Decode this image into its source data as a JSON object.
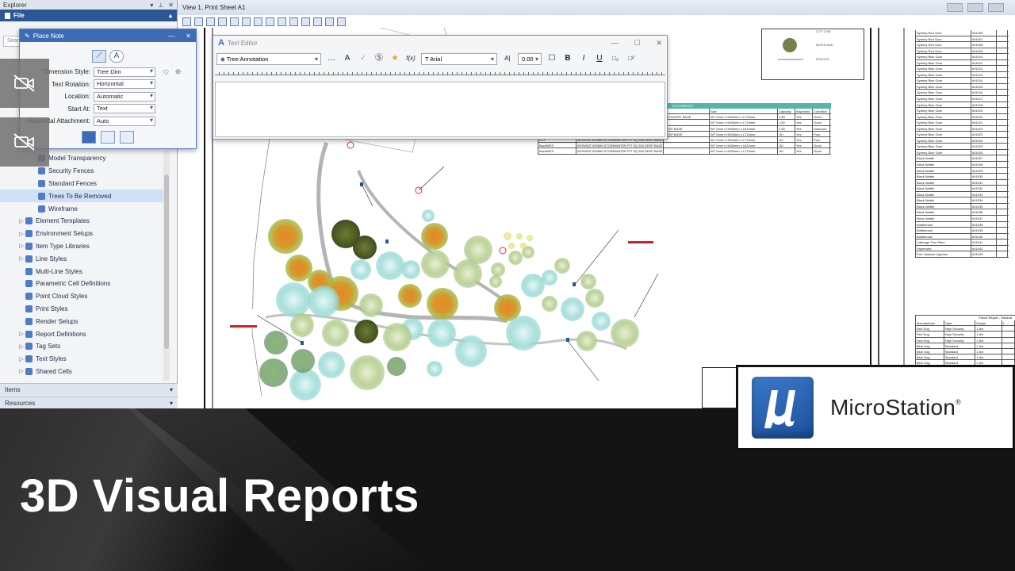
{
  "explorer": {
    "title": "Explorer",
    "file_tab": "File",
    "search_placeholder": "Sear",
    "tree_items": [
      {
        "label": "Model Transparency",
        "level": 2
      },
      {
        "label": "Security Fences",
        "level": 2
      },
      {
        "label": "Standard Fences",
        "level": 2
      },
      {
        "label": "Trees To Be Removed",
        "level": 2,
        "selected": true
      },
      {
        "label": "Wireframe",
        "level": 2
      },
      {
        "label": "Element Templates",
        "level": 1,
        "expandable": true
      },
      {
        "label": "Environment Setups",
        "level": 1,
        "expandable": true
      },
      {
        "label": "Item Type Libraries",
        "level": 1,
        "expandable": true
      },
      {
        "label": "Line Styles",
        "level": 1,
        "expandable": true
      },
      {
        "label": "Multi-Line Styles",
        "level": 1
      },
      {
        "label": "Parametric Cell Definitions",
        "level": 1
      },
      {
        "label": "Point Cloud Styles",
        "level": 1
      },
      {
        "label": "Print Styles",
        "level": 1
      },
      {
        "label": "Render Setups",
        "level": 1
      },
      {
        "label": "Report Definitions",
        "level": 1,
        "expandable": true
      },
      {
        "label": "Tag Sets",
        "level": 1,
        "expandable": true
      },
      {
        "label": "Text Styles",
        "level": 1,
        "expandable": true
      },
      {
        "label": "Shared Cells",
        "level": 1,
        "expandable": true
      }
    ],
    "items_section": "Items",
    "resources_section": "Resources"
  },
  "place_note": {
    "title": "Place Note",
    "fields": [
      {
        "label": "Dimension Style:",
        "value": "Tree Dim"
      },
      {
        "label": "Text Rotation:",
        "value": "Horizontal"
      },
      {
        "label": "Location:",
        "value": "Automatic"
      },
      {
        "label": "Start At:",
        "value": "Text"
      },
      {
        "label": "Horizontal Attachment:",
        "value": "Auto"
      }
    ]
  },
  "view": {
    "title": "View 1, Print Sheet A1"
  },
  "text_editor": {
    "title": "Text Editor",
    "style": "Tree Annotation",
    "font": "Arial",
    "size": "0.00",
    "bold": "B",
    "italic": "I",
    "underline": "U"
  },
  "pits_report": {
    "title": "PITS REPORT",
    "headers": [
      "",
      "Type",
      "Size",
      "Capacity",
      "Inspected",
      "Condition"
    ],
    "rows": [
      [
        "",
        "",
        "300 SHORT BASE",
        "WT 0mm x H450mm x L710mm",
        "1.80",
        "Yes",
        "Good"
      ],
      [
        "",
        "",
        "",
        "WT 0mm x H450mm x L710mm",
        "1.50",
        "Yes",
        "Good"
      ],
      [
        "",
        "",
        "DEEP BASE",
        "WT 0mm x H450mm x L810mm",
        "1.50",
        "Yes",
        "Unknown"
      ],
      [
        "",
        "",
        "DEEP BASE",
        "WT 0mm x H500mm x L710mm",
        ".50",
        "Yes",
        "Poor"
      ],
      [
        "ECP",
        "WOWSAT 600MM STORMWATER PIT SQ 300 DEEP BASE",
        "",
        "WT 0mm x H500mm x L710mm",
        ".50",
        "Yes",
        "Poor"
      ],
      [
        "BackWKS",
        "WOWSAT 600MM STORMWATER PIT SQ 300 DEEP BASE",
        "",
        "WT 0mm x H450mm x L810mm",
        ".50",
        "Yes",
        "Good"
      ],
      [
        "BackWKS",
        "WOWSAT 600MM STORMWATER PIT SQ 300 DEEP BASE",
        "",
        "WT 0mm x H450mm x L710mm",
        ".50",
        "Yes",
        "Good"
      ]
    ]
  },
  "tree_list": {
    "rows": [
      [
        "Sydney Red Gum",
        "#01006"
      ],
      [
        "Sydney Red Gum",
        "#01007"
      ],
      [
        "Sydney Red Gum",
        "#01008"
      ],
      [
        "Sydney Red Gum",
        "#01009"
      ],
      [
        "Sydney Blue Gum",
        "#01010"
      ],
      [
        "Sydney Blue Gum",
        "#01011"
      ],
      [
        "Sydney Blue Gum",
        "#01012"
      ],
      [
        "Sydney Blue Gum",
        "#01013"
      ],
      [
        "Sydney Blue Gum",
        "#01014"
      ],
      [
        "Sydney Blue Gum",
        "#01015"
      ],
      [
        "Sydney Blue Gum",
        "#01016"
      ],
      [
        "Sydney Blue Gum",
        "#01017"
      ],
      [
        "Sydney Blue Gum",
        "#01018"
      ],
      [
        "Sydney Blue Gum",
        "#01019"
      ],
      [
        "Sydney Blue Gum",
        "#01020"
      ],
      [
        "Sydney Blue Gum",
        "#01021"
      ],
      [
        "Sydney Blue Gum",
        "#01022"
      ],
      [
        "Sydney Blue Gum",
        "#01023"
      ],
      [
        "Sydney Blue Gum",
        "#01024"
      ],
      [
        "Sydney Blue Gum",
        "#01025"
      ],
      [
        "Sydney Blue Gum",
        "#01026"
      ],
      [
        "Black Wattle",
        "#01027"
      ],
      [
        "Black Wattle",
        "#01028"
      ],
      [
        "Black Wattle",
        "#01029"
      ],
      [
        "Black Wattle",
        "#01030"
      ],
      [
        "Black Wattle",
        "#01031"
      ],
      [
        "Black Wattle",
        "#01032"
      ],
      [
        "Black Wattle",
        "#01033"
      ],
      [
        "Black Wattle",
        "#01034"
      ],
      [
        "Black Wattle",
        "#01035"
      ],
      [
        "Black Wattle",
        "#01036"
      ],
      [
        "Black Wattle",
        "#01037"
      ],
      [
        "Bottlebrush",
        "#01038"
      ],
      [
        "Bottlebrush",
        "#01039"
      ],
      [
        "Bottlebrush",
        "#01040"
      ],
      [
        "Cabbage Tree Palm",
        "#01041"
      ],
      [
        "Paperbark",
        "#01042"
      ],
      [
        "Port Jackson Cypress",
        "#01043"
      ]
    ]
  },
  "fence_report": {
    "title": "Fence Report - Summa",
    "headers": [
      "Manufacturer",
      "Type",
      "Height",
      "L"
    ],
    "rows": [
      [
        "Red Dog",
        "High Security",
        "1.8m"
      ],
      [
        "Red Dog",
        "High Security",
        "1.8m"
      ],
      [
        "Red Dog",
        "High Security",
        "1.8m"
      ],
      [
        "Blue Dog",
        "Standard",
        "1.5m"
      ],
      [
        "Blue Dog",
        "Standard",
        "1.5m"
      ],
      [
        "Blue Dog",
        "Standard",
        "1.5m"
      ],
      [
        "Blue Dog",
        "Standard",
        "1.5m"
      ]
    ]
  },
  "legend": {
    "items": [
      "CITY LINE",
      "BUSHLAND",
      "FENCES"
    ]
  },
  "banner": {
    "title": "3D Visual Reports"
  },
  "logo": {
    "name": "MicroStation",
    "mark": "®"
  }
}
